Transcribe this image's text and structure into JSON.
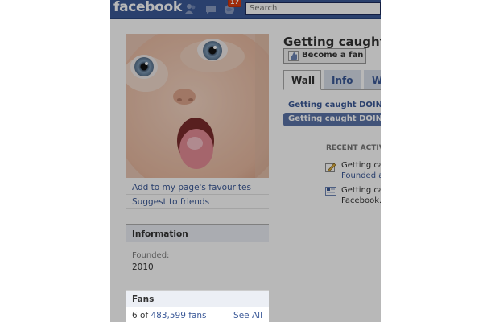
{
  "brand": {
    "logo_text": "facebook"
  },
  "header": {
    "notifications_count": "17",
    "search_placeholder": "Search"
  },
  "page": {
    "title": "Getting caught",
    "fan_button_label": "Become a fan",
    "tabs": [
      {
        "label": "Wall"
      },
      {
        "label": "Info"
      },
      {
        "label": "W"
      }
    ],
    "subnav": {
      "link_label": "Getting caught DOING",
      "active_label": "Getting caught DOING"
    }
  },
  "sidebar": {
    "links": [
      {
        "label": "Add to my page's favourites"
      },
      {
        "label": "Suggest to friends"
      }
    ],
    "information": {
      "heading": "Information",
      "founded_label": "Founded:",
      "founded_value": "2010"
    },
    "fans": {
      "heading": "Fans",
      "count_prefix": "6 of ",
      "count_link": "483,599 fans",
      "see_all": "See All"
    }
  },
  "recent_activity": {
    "heading": "RECENT ACTIV",
    "items": [
      {
        "line1": "Getting ca",
        "line2": "Founded a",
        "icon": "pencil-icon"
      },
      {
        "line1": "Getting ca",
        "line2": "Facebook.",
        "icon": "page-icon"
      }
    ]
  },
  "colors": {
    "topbar": "#3b5998",
    "link": "#3b5998",
    "active_nav": "#5b74a8",
    "box_header": "#eceff5"
  }
}
